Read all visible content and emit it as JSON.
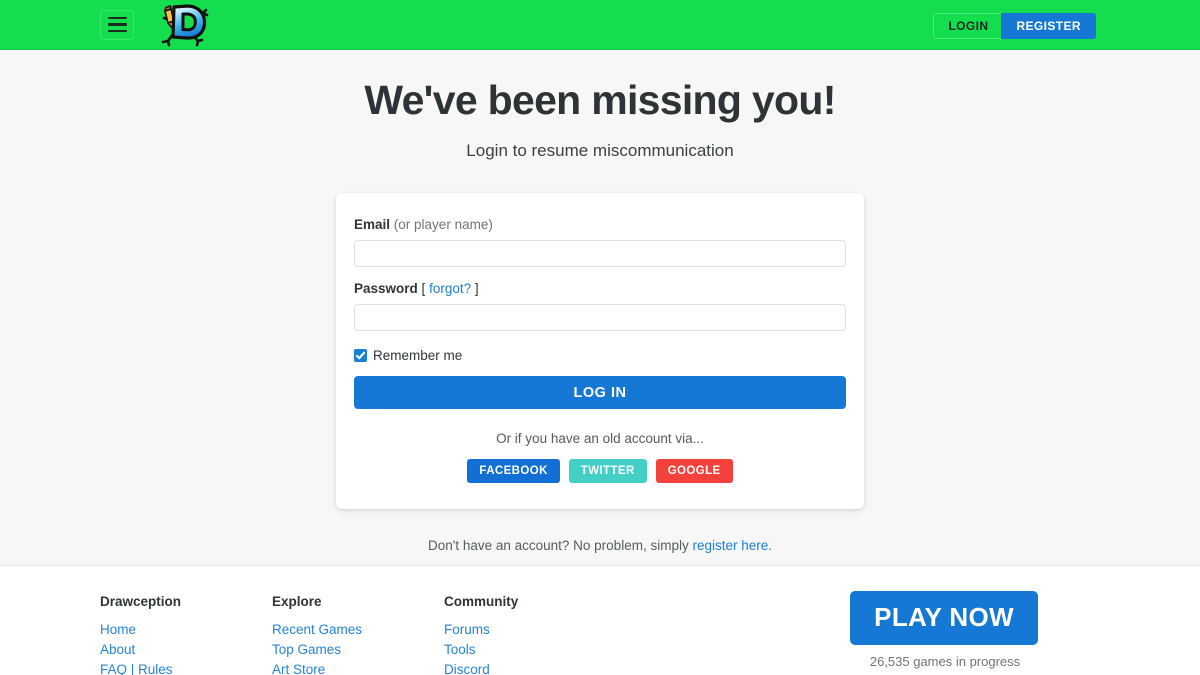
{
  "header": {
    "menu_icon": "hamburger-icon",
    "logo_alt": "Drawception D character logo",
    "login_label": "LOGIN",
    "register_label": "REGISTER",
    "background_color": "#14de4e"
  },
  "main": {
    "title": "We've been missing you!",
    "subtitle": "Login to resume miscommunication",
    "form": {
      "email_label_strong": "Email",
      "email_label_muted": "(or player name)",
      "email_value": "",
      "email_placeholder": "",
      "password_label": "Password",
      "password_forgot_open": "[",
      "password_forgot_link": "forgot?",
      "password_forgot_close": "]",
      "password_value": "",
      "password_placeholder": "",
      "remember_label": "Remember me",
      "remember_checked": true,
      "submit_label": "LOG IN",
      "submit_color": "#1478d4"
    },
    "social": {
      "heading": "Or if you have an old account via...",
      "buttons": [
        {
          "label": "FACEBOOK",
          "color": "#1270d4"
        },
        {
          "label": "TWITTER",
          "color": "#43cfc5"
        },
        {
          "label": "GOOGLE",
          "color": "#f5413c"
        }
      ]
    },
    "register_note": {
      "text_before": "Don't have an account? No problem, simply ",
      "link": "register here",
      "text_after": "."
    }
  },
  "footer": {
    "columns": [
      {
        "title": "Drawception",
        "links": [
          "Home",
          "About",
          "FAQ | Rules"
        ]
      },
      {
        "title": "Explore",
        "links": [
          "Recent Games",
          "Top Games",
          "Art Store"
        ]
      },
      {
        "title": "Community",
        "links": [
          "Forums",
          "Tools",
          "Discord"
        ]
      }
    ],
    "cta": {
      "play_label": "PLAY NOW",
      "games_in_progress": "26,535 games in progress"
    }
  }
}
